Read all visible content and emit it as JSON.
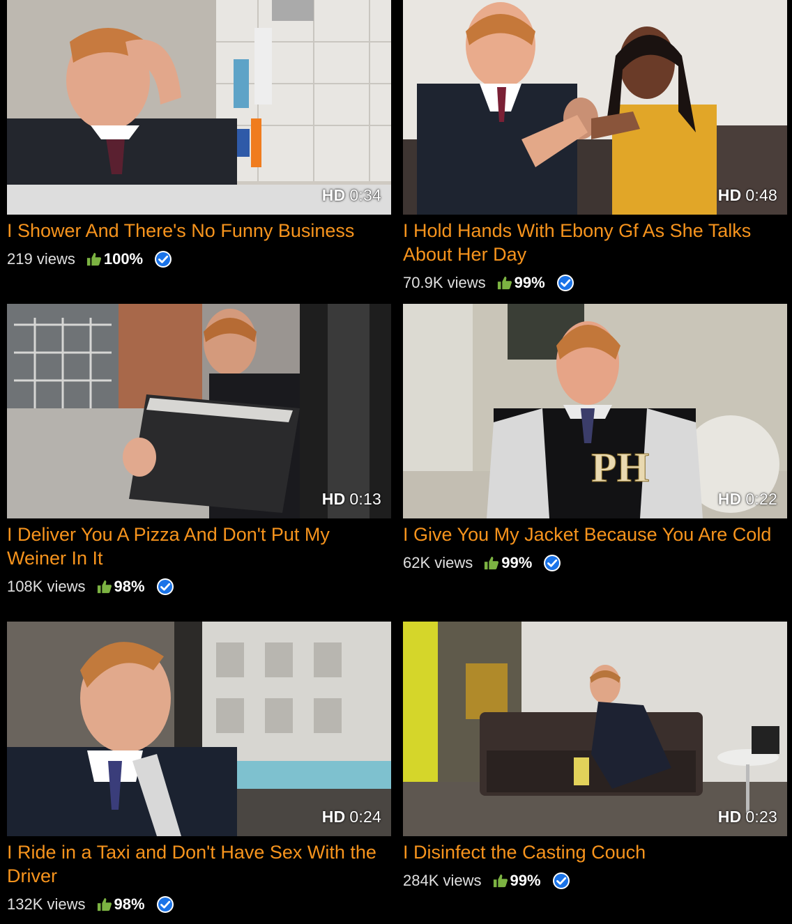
{
  "colors": {
    "title": "#f7941d",
    "background": "#000000",
    "thumb_up": "#7cb342",
    "verified": "#1a73e8"
  },
  "videos": [
    {
      "hd_label": "HD",
      "duration": "0:34",
      "title": "I Shower And There's No Funny Business",
      "views": "219 views",
      "rating": "100%",
      "thumb_up_icon": "thumbs-up-icon",
      "verified_icon": "verified-check-icon"
    },
    {
      "hd_label": "HD",
      "duration": "0:48",
      "title": "I Hold Hands With Ebony Gf As She Talks About Her Day",
      "views": "70.9K views",
      "rating": "99%",
      "thumb_up_icon": "thumbs-up-icon",
      "verified_icon": "verified-check-icon"
    },
    {
      "hd_label": "HD",
      "duration": "0:13",
      "title": "I Deliver You A Pizza And Don't Put My Weiner In It",
      "views": "108K views",
      "rating": "98%",
      "thumb_up_icon": "thumbs-up-icon",
      "verified_icon": "verified-check-icon"
    },
    {
      "hd_label": "HD",
      "duration": "0:22",
      "title": "I Give You My Jacket Because You Are Cold",
      "views": "62K views",
      "rating": "99%",
      "thumb_up_icon": "thumbs-up-icon",
      "verified_icon": "verified-check-icon"
    },
    {
      "hd_label": "HD",
      "duration": "0:24",
      "title": "I Ride in a Taxi and Don't Have Sex With the Driver",
      "views": "132K views",
      "rating": "98%",
      "thumb_up_icon": "thumbs-up-icon",
      "verified_icon": "verified-check-icon"
    },
    {
      "hd_label": "HD",
      "duration": "0:23",
      "title": "I Disinfect the Casting Couch",
      "views": "284K views",
      "rating": "99%",
      "thumb_up_icon": "thumbs-up-icon",
      "verified_icon": "verified-check-icon"
    }
  ]
}
